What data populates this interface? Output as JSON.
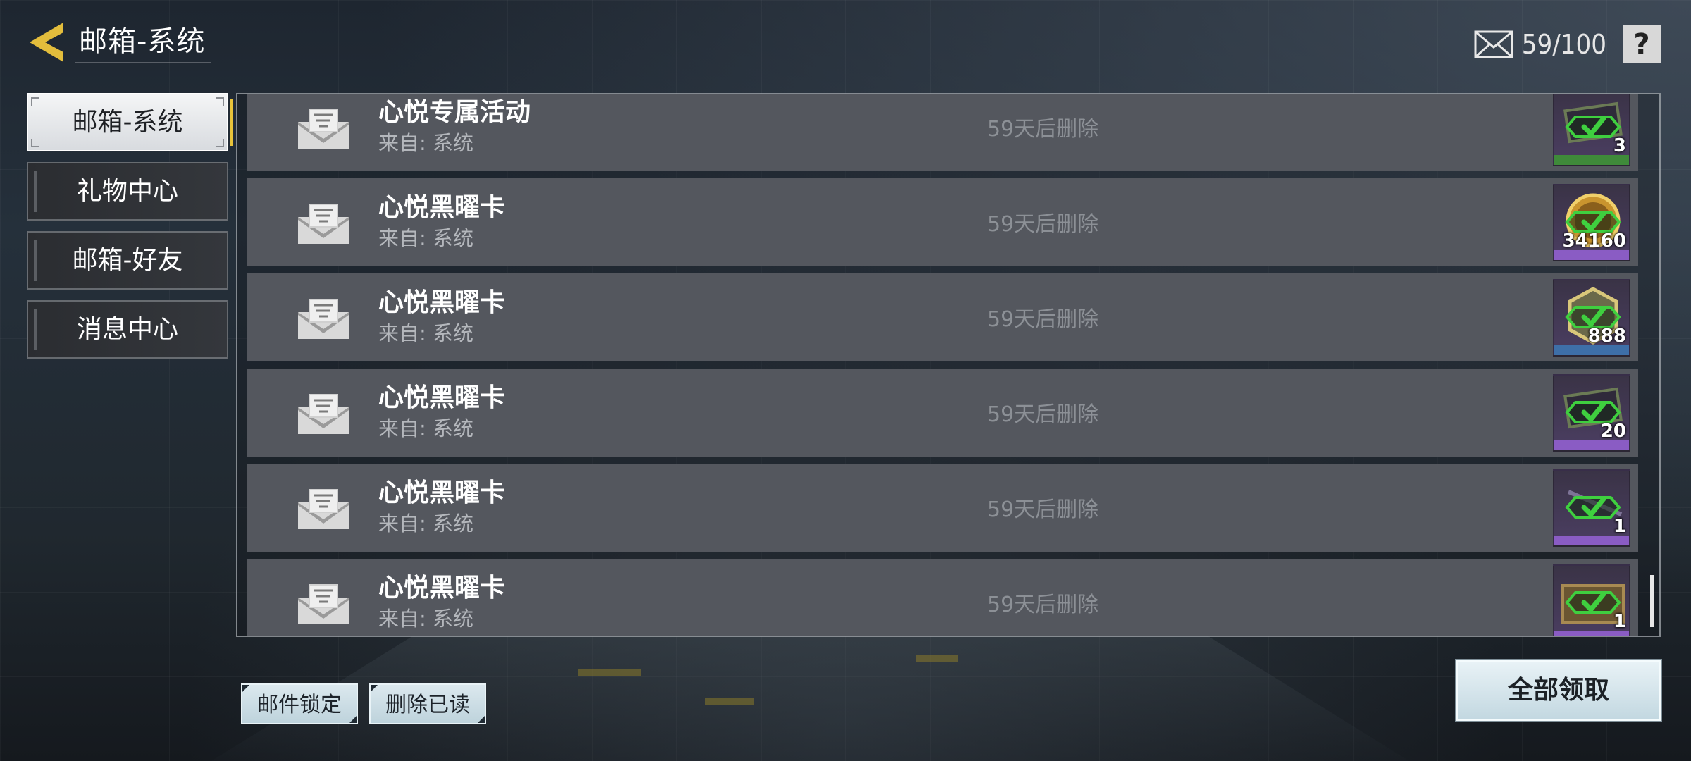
{
  "header": {
    "title": "邮箱-系统",
    "mail_count": "59/100",
    "help_label": "?"
  },
  "sidebar": {
    "items": [
      {
        "label": "邮箱-系统",
        "active": true
      },
      {
        "label": "礼物中心",
        "active": false
      },
      {
        "label": "邮箱-好友",
        "active": false
      },
      {
        "label": "消息中心",
        "active": false
      }
    ]
  },
  "mails": [
    {
      "title": "心悦专属活动",
      "from": "来自: 系统",
      "expire": "59天后删除",
      "reward_qty": "3",
      "reward_icon": "ticket-icon",
      "reward_color": "#3f8a3a"
    },
    {
      "title": "心悦黑曜卡",
      "from": "来自: 系统",
      "expire": "59天后删除",
      "reward_qty": "34160",
      "reward_icon": "coin-icon",
      "reward_color": "#8a5cc4"
    },
    {
      "title": "心悦黑曜卡",
      "from": "来自: 系统",
      "expire": "59天后删除",
      "reward_qty": "888",
      "reward_icon": "badge-icon",
      "reward_color": "#3e6fa8"
    },
    {
      "title": "心悦黑曜卡",
      "from": "来自: 系统",
      "expire": "59天后删除",
      "reward_qty": "20",
      "reward_icon": "ticket-icon",
      "reward_color": "#8a5cc4"
    },
    {
      "title": "心悦黑曜卡",
      "from": "来自: 系统",
      "expire": "59天后删除",
      "reward_qty": "1",
      "reward_icon": "weapon-icon",
      "reward_color": "#8a5cc4"
    },
    {
      "title": "心悦黑曜卡",
      "from": "来自: 系统",
      "expire": "59天后删除",
      "reward_qty": "1",
      "reward_icon": "crate-icon",
      "reward_color": "#8a5cc4"
    }
  ],
  "footer": {
    "lock_label": "邮件锁定",
    "delete_read_label": "删除已读",
    "claim_all_label": "全部领取"
  },
  "colors": {
    "active_accent": "#e8c33a",
    "claimed_check": "#3fcf3f"
  }
}
